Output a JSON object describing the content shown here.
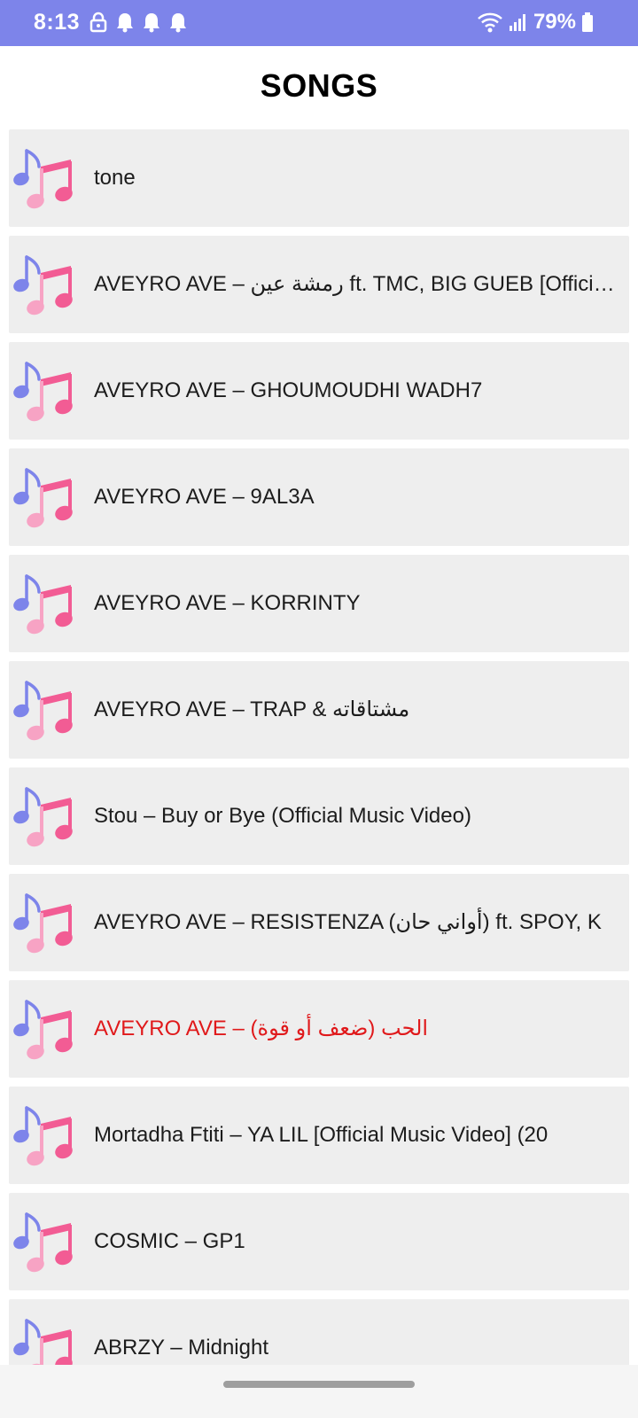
{
  "status_bar": {
    "time": "8:13",
    "battery": "79%",
    "background_color": "#7d84ea",
    "left_icons": [
      "lock-icon",
      "bell-icon",
      "bell-icon",
      "bell-icon"
    ],
    "right_icons": [
      "wifi-icon",
      "signal-icon",
      "battery-icon"
    ]
  },
  "header": {
    "title": "SONGS"
  },
  "song_list": {
    "active_color": "#e0191b",
    "icon_colors": {
      "small_note": "#7d84ea",
      "large_note": "#f25c94"
    },
    "items": [
      {
        "title": "",
        "active": false
      },
      {
        "title": "tone",
        "active": false
      },
      {
        "title": "AVEYRO AVE – رمشة عين ft. TMC, BIG GUEB [Official Music Video]",
        "active": false
      },
      {
        "title": "AVEYRO AVE – GHOUMOUDHI WADH7",
        "active": false
      },
      {
        "title": "AVEYRO AVE – 9AL3A",
        "active": false
      },
      {
        "title": "AVEYRO AVE – KORRINTY",
        "active": false
      },
      {
        "title": "AVEYRO AVE – TRAP & مشتاقاته",
        "active": false
      },
      {
        "title": "Stou – Buy or Bye (Official Music Video)",
        "active": false
      },
      {
        "title": "AVEYRO AVE – RESISTENZA (أواني حان) ft. SPOY, K",
        "active": false
      },
      {
        "title": "AVEYRO AVE – الحب (ضعف أو قوة)",
        "active": true
      },
      {
        "title": "Mortadha Ftiti – YA LIL [Official Music Video] (20",
        "active": false
      },
      {
        "title": "COSMIC – GP1",
        "active": false
      },
      {
        "title": "ABRZY – Midnight",
        "active": false
      }
    ]
  }
}
